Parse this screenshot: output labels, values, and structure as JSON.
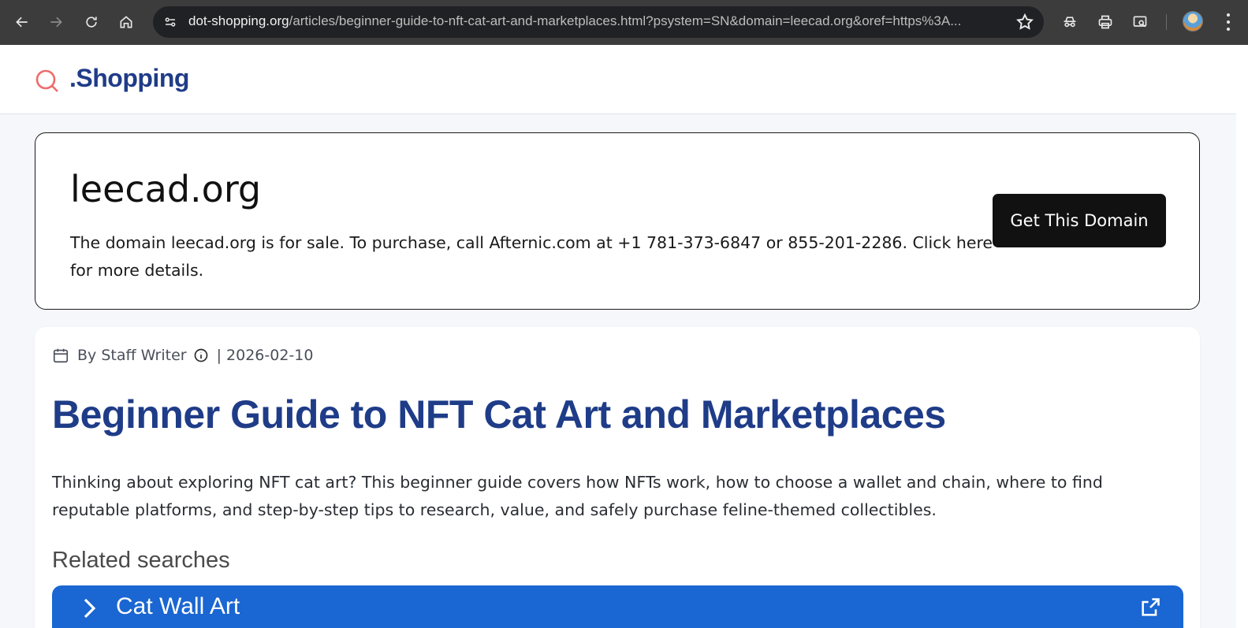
{
  "browser": {
    "url_host": "dot-shopping.org",
    "url_rest": "/articles/beginner-guide-to-nft-cat-art-and-marketplaces.html?psystem=SN&domain=leecad.org&oref=https%3A..."
  },
  "site": {
    "logo_text": ".Shopping"
  },
  "domain_card": {
    "title": "leecad.org",
    "description": "The domain leecad.org is for sale. To purchase, call Afternic.com at +1 781-373-6847 or 855-201-2286. Click here for more details.",
    "button_label": "Get This Domain"
  },
  "article": {
    "author": "By Staff Writer",
    "date": "| 2026-02-10",
    "title": "Beginner Guide to NFT Cat Art and Marketplaces",
    "summary": "Thinking about exploring NFT cat art? This beginner guide covers how NFTs work, how to choose a wallet and chain, where to find reputable platforms, and step-by-step tips to research, value, and safely purchase feline-themed collectibles."
  },
  "related": {
    "title": "Related searches",
    "items": [
      {
        "label": "Cat Wall Art"
      }
    ]
  },
  "colors": {
    "brand_blue": "#1f3c88",
    "accent_red": "#ef6b6b",
    "related_blue": "#1a66d2",
    "chrome_bg": "#3c3c3c"
  },
  "icons": [
    "back-icon",
    "forward-icon",
    "reload-icon",
    "home-icon",
    "site-info-icon",
    "star-icon",
    "incognito-icon",
    "print-icon",
    "search-tab-icon",
    "profile-avatar",
    "menu-icon",
    "search-logo-icon",
    "calendar-icon",
    "info-icon",
    "chevron-right-icon",
    "external-link-icon"
  ]
}
